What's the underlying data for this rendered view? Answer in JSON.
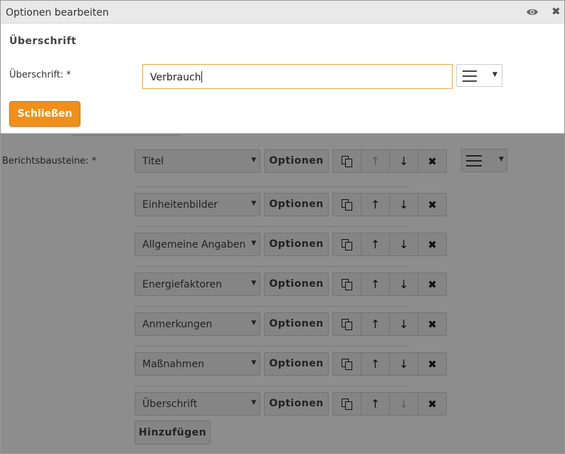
{
  "dialog": {
    "title": "Optionen bearbeiten",
    "section_title": "Überschrift",
    "field_label": "Überschrift: *",
    "field_value": "Verbrauch",
    "close_button": "Schließen"
  },
  "form": {
    "label": "Berichtsbausteine: *",
    "options_label": "Optionen",
    "add_button": "Hinzufügen",
    "rows": [
      {
        "value": "Titel",
        "up_disabled": true,
        "down_disabled": false
      },
      {
        "value": "Einheitenbilder",
        "up_disabled": false,
        "down_disabled": false
      },
      {
        "value": "Allgemeine Angaben",
        "up_disabled": false,
        "down_disabled": false
      },
      {
        "value": "Energiefaktoren",
        "up_disabled": false,
        "down_disabled": false
      },
      {
        "value": "Anmerkungen",
        "up_disabled": false,
        "down_disabled": false
      },
      {
        "value": "Maßnahmen",
        "up_disabled": false,
        "down_disabled": false
      },
      {
        "value": "Überschrift",
        "up_disabled": false,
        "down_disabled": true
      }
    ]
  },
  "icons": {
    "preview": "eye-icon",
    "close": "close-icon",
    "format": "hamburger-menu-icon",
    "copy": "copy-icon",
    "up": "arrow-up-icon",
    "down": "arrow-down-icon",
    "remove": "remove-icon"
  }
}
